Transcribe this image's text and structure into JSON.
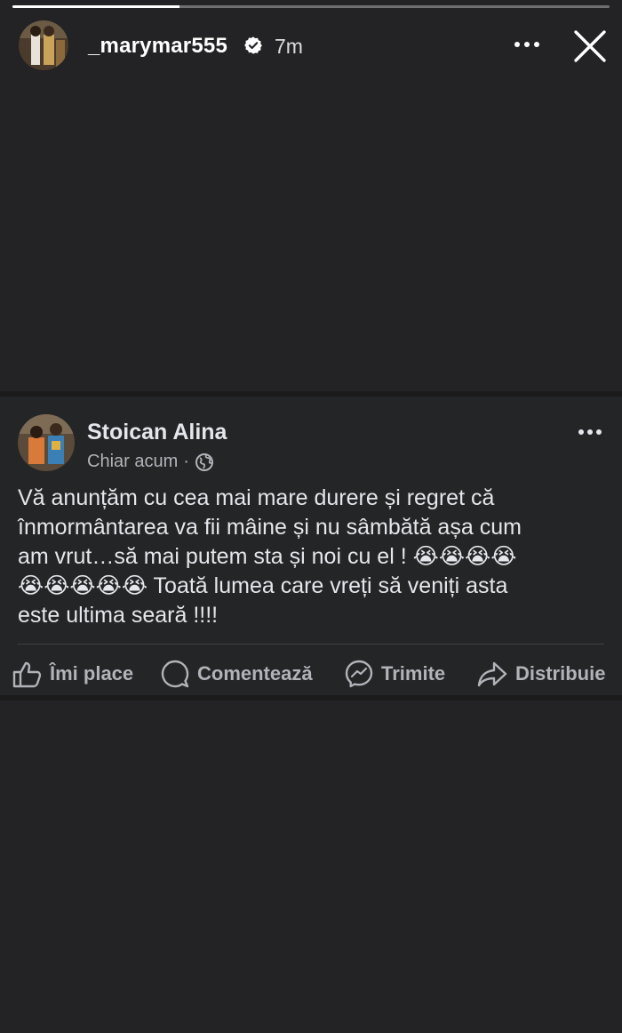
{
  "story": {
    "username": "_marymar555",
    "time": "7m",
    "progress": 0.28,
    "icons": {
      "verified": "verified-badge-icon",
      "more": "more-dots-icon",
      "close": "close-icon"
    }
  },
  "post": {
    "author": "Stoican Alina",
    "timestamp": "Chiar acum",
    "separator": "·",
    "privacy_icon": "globe-icon",
    "text_line1": "Vă anunțăm cu cea mai mare durere și regret că",
    "text_line2": "înmormântarea va fii mâine și nu sâmbătă așa cum",
    "text_line3": "am vrut…să mai putem sta și noi cu el ! 😭😭😭😭",
    "text_line4": "😭😭😭😭😭  Toată lumea care vreți să veniți asta",
    "text_line5": "este ultima seară !!!!",
    "actions": {
      "like": "Îmi place",
      "comment": "Comentează",
      "send": "Trimite",
      "share": "Distribuie"
    }
  },
  "colors": {
    "background": "#232325",
    "card": "#242526",
    "text": "#e4e6eb",
    "secondary": "#b0b3b8"
  }
}
